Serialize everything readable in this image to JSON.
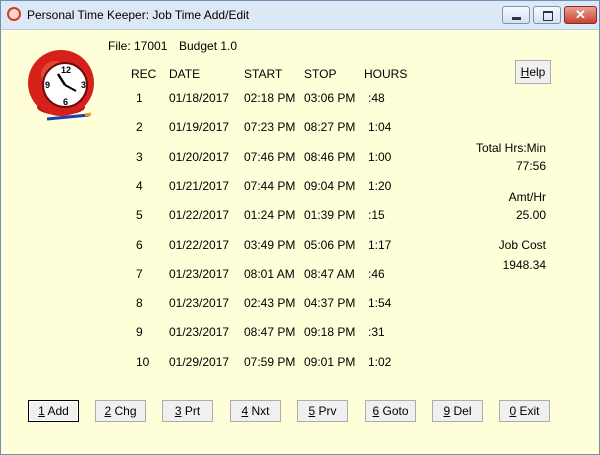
{
  "window": {
    "title": "Personal Time Keeper: Job Time Add/Edit"
  },
  "job": {
    "file_label": "File:",
    "file_value": "17001",
    "budget": "Budget 1.0"
  },
  "table": {
    "headers": {
      "rec": "REC",
      "date": "DATE",
      "start": "START",
      "stop": "STOP",
      "hours": "HOURS"
    },
    "rows": [
      {
        "rec": "1",
        "date": "01/18/2017",
        "start": "02:18 PM",
        "stop": "03:06 PM",
        "hours": ":48"
      },
      {
        "rec": "2",
        "date": "01/19/2017",
        "start": "07:23 PM",
        "stop": "08:27 PM",
        "hours": "1:04"
      },
      {
        "rec": "3",
        "date": "01/20/2017",
        "start": "07:46 PM",
        "stop": "08:46 PM",
        "hours": "1:00"
      },
      {
        "rec": "4",
        "date": "01/21/2017",
        "start": "07:44 PM",
        "stop": "09:04 PM",
        "hours": "1:20"
      },
      {
        "rec": "5",
        "date": "01/22/2017",
        "start": "01:24 PM",
        "stop": "01:39 PM",
        "hours": ":15"
      },
      {
        "rec": "6",
        "date": "01/22/2017",
        "start": "03:49 PM",
        "stop": "05:06 PM",
        "hours": "1:17"
      },
      {
        "rec": "7",
        "date": "01/23/2017",
        "start": "08:01 AM",
        "stop": "08:47 AM",
        "hours": ":46"
      },
      {
        "rec": "8",
        "date": "01/23/2017",
        "start": "02:43 PM",
        "stop": "04:37 PM",
        "hours": "1:54"
      },
      {
        "rec": "9",
        "date": "01/23/2017",
        "start": "08:47 PM",
        "stop": "09:18 PM",
        "hours": ":31"
      },
      {
        "rec": "10",
        "date": "01/29/2017",
        "start": "07:59 PM",
        "stop": "09:01 PM",
        "hours": "1:02"
      }
    ]
  },
  "summary": {
    "total_label": "Total Hrs:Min",
    "total_value": "77:56",
    "rate_label": "Amt/Hr",
    "rate_value": "25.00",
    "cost_label": "Job Cost",
    "cost_value": "1948.34"
  },
  "help_button": {
    "key": "H",
    "rest": "elp"
  },
  "buttons": [
    {
      "key": "1",
      "rest": " Add"
    },
    {
      "key": "2",
      "rest": " Chg"
    },
    {
      "key": "3",
      "rest": " Prt"
    },
    {
      "key": "4",
      "rest": " Nxt"
    },
    {
      "key": "5",
      "rest": " Prv"
    },
    {
      "key": "6",
      "rest": " Goto"
    },
    {
      "key": "9",
      "rest": " Del"
    },
    {
      "key": "0",
      "rest": " Exit"
    }
  ],
  "icons": {
    "app": "stopwatch-icon",
    "clock": "alarm-clock-icon",
    "minimize": "minimize-icon",
    "maximize": "maximize-icon",
    "close": "close-icon"
  },
  "colors": {
    "background": "#fefed8",
    "titlebar": "#dce8f5",
    "clock_red": "#d8201a",
    "close_red": "#c84231"
  }
}
